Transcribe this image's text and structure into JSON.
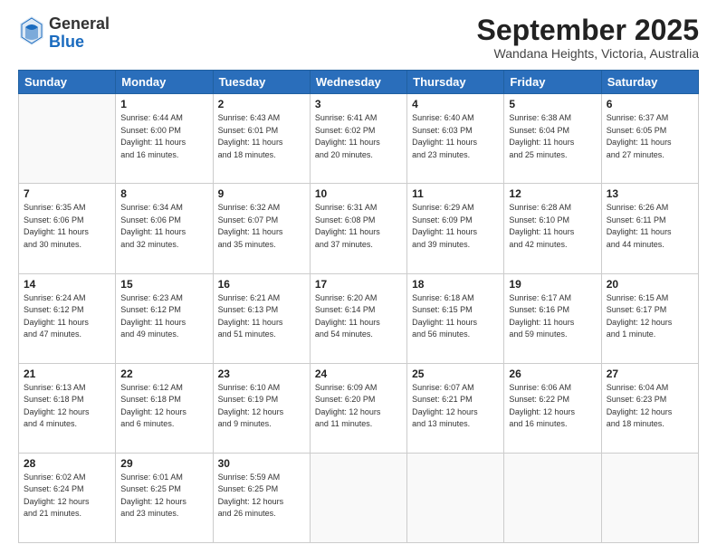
{
  "header": {
    "logo_general": "General",
    "logo_blue": "Blue",
    "month_title": "September 2025",
    "location": "Wandana Heights, Victoria, Australia"
  },
  "calendar": {
    "days_of_week": [
      "Sunday",
      "Monday",
      "Tuesday",
      "Wednesday",
      "Thursday",
      "Friday",
      "Saturday"
    ],
    "weeks": [
      [
        {
          "day": "",
          "info": ""
        },
        {
          "day": "1",
          "info": "Sunrise: 6:44 AM\nSunset: 6:00 PM\nDaylight: 11 hours\nand 16 minutes."
        },
        {
          "day": "2",
          "info": "Sunrise: 6:43 AM\nSunset: 6:01 PM\nDaylight: 11 hours\nand 18 minutes."
        },
        {
          "day": "3",
          "info": "Sunrise: 6:41 AM\nSunset: 6:02 PM\nDaylight: 11 hours\nand 20 minutes."
        },
        {
          "day": "4",
          "info": "Sunrise: 6:40 AM\nSunset: 6:03 PM\nDaylight: 11 hours\nand 23 minutes."
        },
        {
          "day": "5",
          "info": "Sunrise: 6:38 AM\nSunset: 6:04 PM\nDaylight: 11 hours\nand 25 minutes."
        },
        {
          "day": "6",
          "info": "Sunrise: 6:37 AM\nSunset: 6:05 PM\nDaylight: 11 hours\nand 27 minutes."
        }
      ],
      [
        {
          "day": "7",
          "info": "Sunrise: 6:35 AM\nSunset: 6:06 PM\nDaylight: 11 hours\nand 30 minutes."
        },
        {
          "day": "8",
          "info": "Sunrise: 6:34 AM\nSunset: 6:06 PM\nDaylight: 11 hours\nand 32 minutes."
        },
        {
          "day": "9",
          "info": "Sunrise: 6:32 AM\nSunset: 6:07 PM\nDaylight: 11 hours\nand 35 minutes."
        },
        {
          "day": "10",
          "info": "Sunrise: 6:31 AM\nSunset: 6:08 PM\nDaylight: 11 hours\nand 37 minutes."
        },
        {
          "day": "11",
          "info": "Sunrise: 6:29 AM\nSunset: 6:09 PM\nDaylight: 11 hours\nand 39 minutes."
        },
        {
          "day": "12",
          "info": "Sunrise: 6:28 AM\nSunset: 6:10 PM\nDaylight: 11 hours\nand 42 minutes."
        },
        {
          "day": "13",
          "info": "Sunrise: 6:26 AM\nSunset: 6:11 PM\nDaylight: 11 hours\nand 44 minutes."
        }
      ],
      [
        {
          "day": "14",
          "info": "Sunrise: 6:24 AM\nSunset: 6:12 PM\nDaylight: 11 hours\nand 47 minutes."
        },
        {
          "day": "15",
          "info": "Sunrise: 6:23 AM\nSunset: 6:12 PM\nDaylight: 11 hours\nand 49 minutes."
        },
        {
          "day": "16",
          "info": "Sunrise: 6:21 AM\nSunset: 6:13 PM\nDaylight: 11 hours\nand 51 minutes."
        },
        {
          "day": "17",
          "info": "Sunrise: 6:20 AM\nSunset: 6:14 PM\nDaylight: 11 hours\nand 54 minutes."
        },
        {
          "day": "18",
          "info": "Sunrise: 6:18 AM\nSunset: 6:15 PM\nDaylight: 11 hours\nand 56 minutes."
        },
        {
          "day": "19",
          "info": "Sunrise: 6:17 AM\nSunset: 6:16 PM\nDaylight: 11 hours\nand 59 minutes."
        },
        {
          "day": "20",
          "info": "Sunrise: 6:15 AM\nSunset: 6:17 PM\nDaylight: 12 hours\nand 1 minute."
        }
      ],
      [
        {
          "day": "21",
          "info": "Sunrise: 6:13 AM\nSunset: 6:18 PM\nDaylight: 12 hours\nand 4 minutes."
        },
        {
          "day": "22",
          "info": "Sunrise: 6:12 AM\nSunset: 6:18 PM\nDaylight: 12 hours\nand 6 minutes."
        },
        {
          "day": "23",
          "info": "Sunrise: 6:10 AM\nSunset: 6:19 PM\nDaylight: 12 hours\nand 9 minutes."
        },
        {
          "day": "24",
          "info": "Sunrise: 6:09 AM\nSunset: 6:20 PM\nDaylight: 12 hours\nand 11 minutes."
        },
        {
          "day": "25",
          "info": "Sunrise: 6:07 AM\nSunset: 6:21 PM\nDaylight: 12 hours\nand 13 minutes."
        },
        {
          "day": "26",
          "info": "Sunrise: 6:06 AM\nSunset: 6:22 PM\nDaylight: 12 hours\nand 16 minutes."
        },
        {
          "day": "27",
          "info": "Sunrise: 6:04 AM\nSunset: 6:23 PM\nDaylight: 12 hours\nand 18 minutes."
        }
      ],
      [
        {
          "day": "28",
          "info": "Sunrise: 6:02 AM\nSunset: 6:24 PM\nDaylight: 12 hours\nand 21 minutes."
        },
        {
          "day": "29",
          "info": "Sunrise: 6:01 AM\nSunset: 6:25 PM\nDaylight: 12 hours\nand 23 minutes."
        },
        {
          "day": "30",
          "info": "Sunrise: 5:59 AM\nSunset: 6:25 PM\nDaylight: 12 hours\nand 26 minutes."
        },
        {
          "day": "",
          "info": ""
        },
        {
          "day": "",
          "info": ""
        },
        {
          "day": "",
          "info": ""
        },
        {
          "day": "",
          "info": ""
        }
      ]
    ]
  }
}
